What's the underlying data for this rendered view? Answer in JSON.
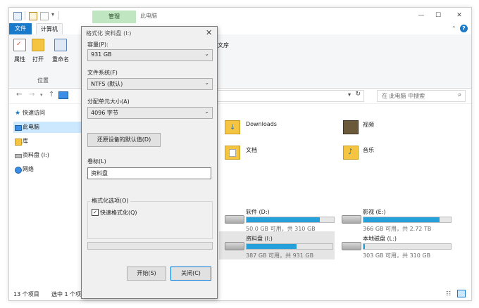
{
  "titlebar": {
    "context_tab": "管理",
    "title": "此电脑"
  },
  "ribbon_tabs": {
    "file": "文件",
    "computer": "计算机"
  },
  "ribbon": {
    "properties": "属性",
    "open": "打开",
    "rename": "重命名",
    "location_group": "位置",
    "partial_label": "文序"
  },
  "address": {
    "search_placeholder": "在 此电脑 中搜索"
  },
  "nav": {
    "items": [
      {
        "label": "快速访问"
      },
      {
        "label": "此电脑"
      },
      {
        "label": "库"
      },
      {
        "label": "资料盘 (I:)"
      },
      {
        "label": "网络"
      }
    ]
  },
  "folders": [
    {
      "label": "Downloads"
    },
    {
      "label": "视频"
    },
    {
      "label": "文档"
    },
    {
      "label": "音乐"
    }
  ],
  "drives": [
    {
      "name": "软件 (D:)",
      "info": "50.0 GB 可用，共 310 GB",
      "used_fraction": 0.84
    },
    {
      "name": "影视 (E:)",
      "info": "366 GB 可用，共 2.72 TB",
      "used_fraction": 0.87
    },
    {
      "name": "资料盘 (I:)",
      "info": "387 GB 可用，共 931 GB",
      "used_fraction": 0.58
    },
    {
      "name": "本地磁盘 (L:)",
      "info": "303 GB 可用，共 310 GB",
      "used_fraction": 0.02
    }
  ],
  "status": {
    "count": "13 个项目",
    "selected": "选中 1 个项目"
  },
  "dialog": {
    "title": "格式化 资料盘 (I:)",
    "capacity_label": "容量(P):",
    "capacity_value": "931 GB",
    "filesystem_label": "文件系统(F)",
    "filesystem_value": "NTFS (默认)",
    "alloc_label": "分配单元大小(A)",
    "alloc_value": "4096 字节",
    "restore_defaults": "还原设备的默认值(D)",
    "volume_label": "卷标(L)",
    "volume_value": "资料盘",
    "options_label": "格式化选项(O)",
    "quick_format": "快速格式化(Q)",
    "quick_format_checked": true,
    "start": "开始(S)",
    "close": "关闭(C)"
  },
  "colors": {
    "accent": "#1979ca",
    "drive_bar": "#26a0da",
    "selection": "#cce8ff",
    "context_tab": "#bfe6c0"
  }
}
